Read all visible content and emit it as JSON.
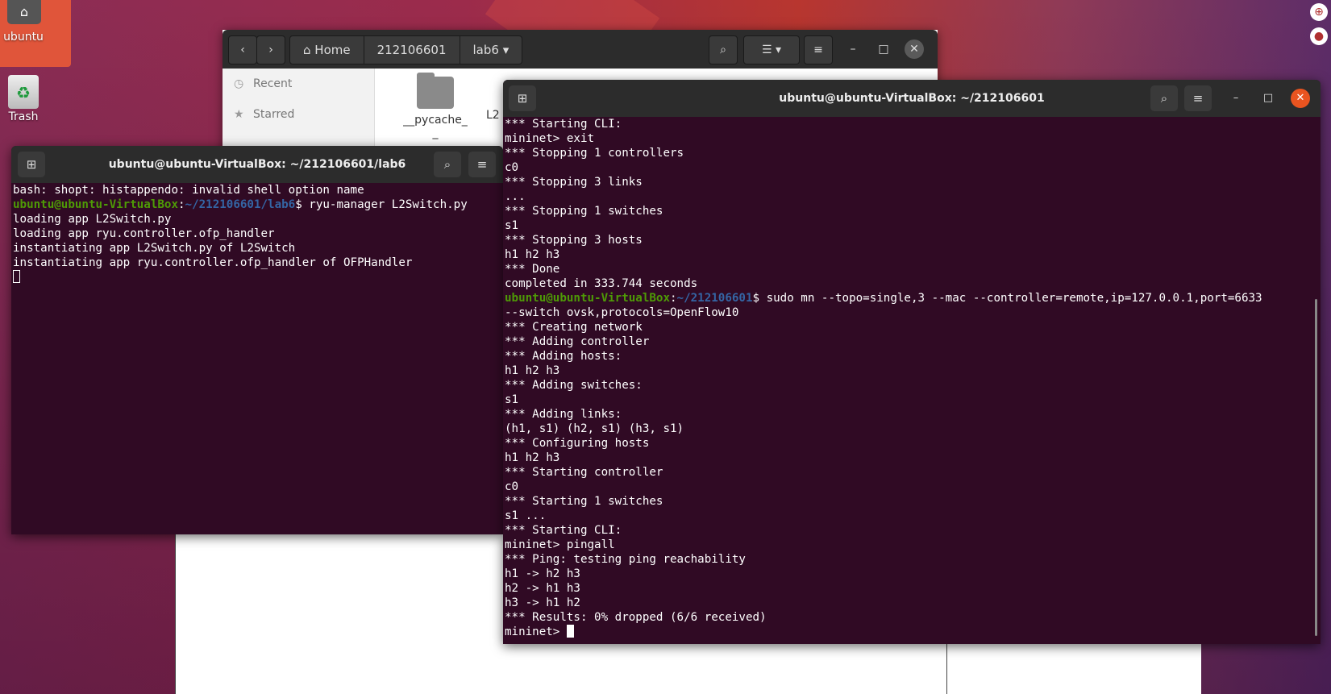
{
  "desktop": {
    "home_label": "ubuntu",
    "trash_label": "Trash"
  },
  "files": {
    "breadcrumbs": [
      "Home",
      "212106601",
      "lab6"
    ],
    "sidebar": [
      "Recent",
      "Starred"
    ],
    "folder_name": "__pycache_\n_",
    "file_partial": "L2"
  },
  "term_left": {
    "title": "ubuntu@ubuntu-VirtualBox: ~/212106601/lab6",
    "lines": [
      {
        "text": "bash: shopt: histappendo: invalid shell option name"
      },
      {
        "user": "ubuntu@ubuntu-VirtualBox",
        "path": "~/212106601/lab6",
        "cmd": "$ ryu-manager L2Switch.py"
      },
      {
        "text": "loading app L2Switch.py"
      },
      {
        "text": "loading app ryu.controller.ofp_handler"
      },
      {
        "text": "instantiating app L2Switch.py of L2Switch"
      },
      {
        "text": "instantiating app ryu.controller.ofp_handler of OFPHandler"
      }
    ]
  },
  "term_right": {
    "title": "ubuntu@ubuntu-VirtualBox: ~/212106601",
    "lines": [
      {
        "text": "*** Starting CLI:"
      },
      {
        "text": "mininet> exit"
      },
      {
        "text": "*** Stopping 1 controllers"
      },
      {
        "text": "c0"
      },
      {
        "text": "*** Stopping 3 links"
      },
      {
        "text": "..."
      },
      {
        "text": "*** Stopping 1 switches"
      },
      {
        "text": "s1"
      },
      {
        "text": "*** Stopping 3 hosts"
      },
      {
        "text": "h1 h2 h3"
      },
      {
        "text": "*** Done"
      },
      {
        "text": "completed in 333.744 seconds"
      },
      {
        "user": "ubuntu@ubuntu-VirtualBox",
        "path": "~/212106601",
        "cmd": "$ sudo mn --topo=single,3 --mac --controller=remote,ip=127.0.0.1,port=6633"
      },
      {
        "text": "--switch ovsk,protocols=OpenFlow10"
      },
      {
        "text": "*** Creating network"
      },
      {
        "text": "*** Adding controller"
      },
      {
        "text": "*** Adding hosts:"
      },
      {
        "text": "h1 h2 h3"
      },
      {
        "text": "*** Adding switches:"
      },
      {
        "text": "s1"
      },
      {
        "text": "*** Adding links:"
      },
      {
        "text": "(h1, s1) (h2, s1) (h3, s1)"
      },
      {
        "text": "*** Configuring hosts"
      },
      {
        "text": "h1 h2 h3"
      },
      {
        "text": "*** Starting controller"
      },
      {
        "text": "c0"
      },
      {
        "text": "*** Starting 1 switches"
      },
      {
        "text": "s1 ..."
      },
      {
        "text": "*** Starting CLI:"
      },
      {
        "text": "mininet> pingall"
      },
      {
        "text": "*** Ping: testing ping reachability"
      },
      {
        "text": "h1 -> h2 h3"
      },
      {
        "text": "h2 -> h1 h3"
      },
      {
        "text": "h3 -> h1 h2"
      },
      {
        "text": "*** Results: 0% dropped (6/6 received)"
      }
    ],
    "prompt": "mininet> "
  }
}
